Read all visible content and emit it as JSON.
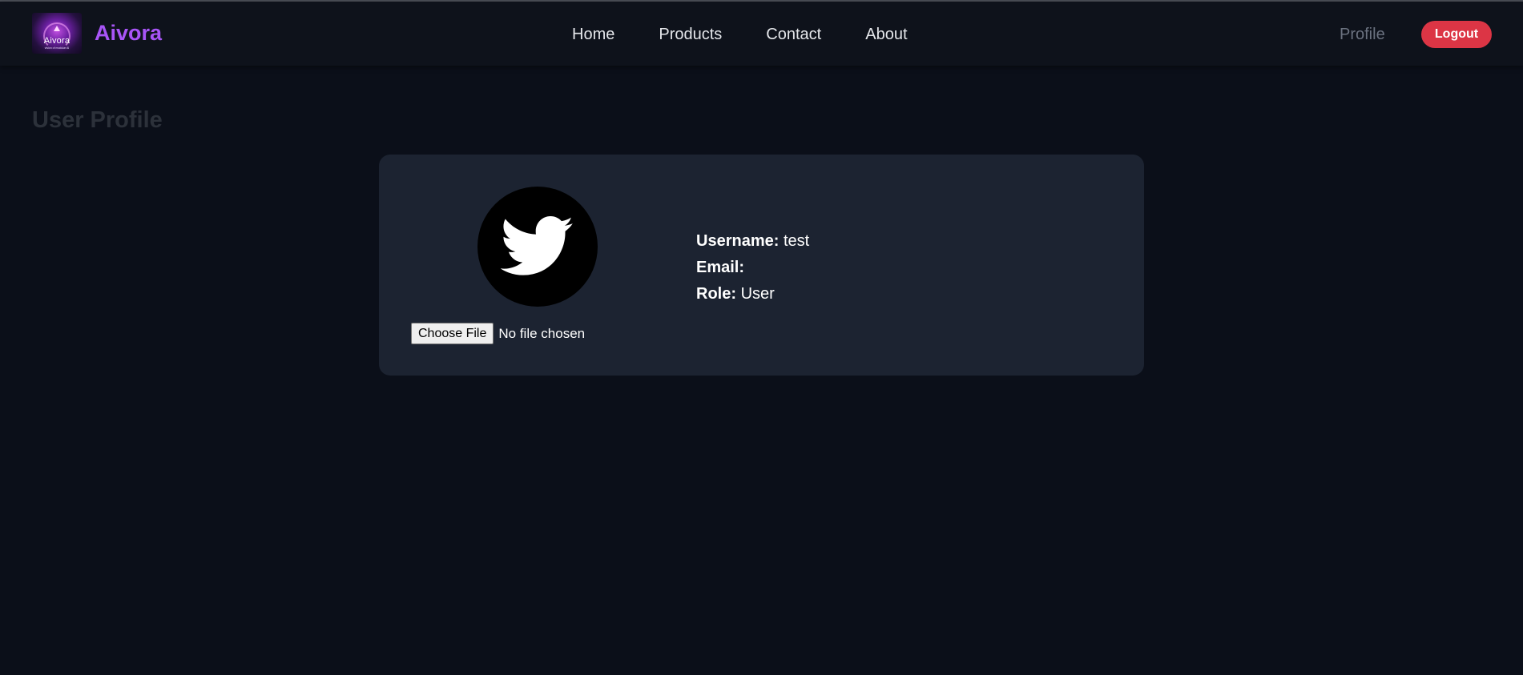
{
  "brand": {
    "logo_text": "Aivora",
    "logo_subtext": "vision of modular AI",
    "name": "Aivora",
    "accent_color": "#a855f7"
  },
  "nav": {
    "items": [
      {
        "label": "Home"
      },
      {
        "label": "Products"
      },
      {
        "label": "Contact"
      },
      {
        "label": "About"
      }
    ],
    "profile_label": "Profile",
    "logout_label": "Logout",
    "logout_color": "#dc3545"
  },
  "page": {
    "title": "User Profile"
  },
  "profile": {
    "avatar_icon": "twitter-bird-icon",
    "choose_file_label": "Choose File",
    "file_status": "No file chosen",
    "username_label": "Username:",
    "username_value": "test",
    "email_label": "Email:",
    "email_value": "",
    "role_label": "Role:",
    "role_value": "User"
  }
}
